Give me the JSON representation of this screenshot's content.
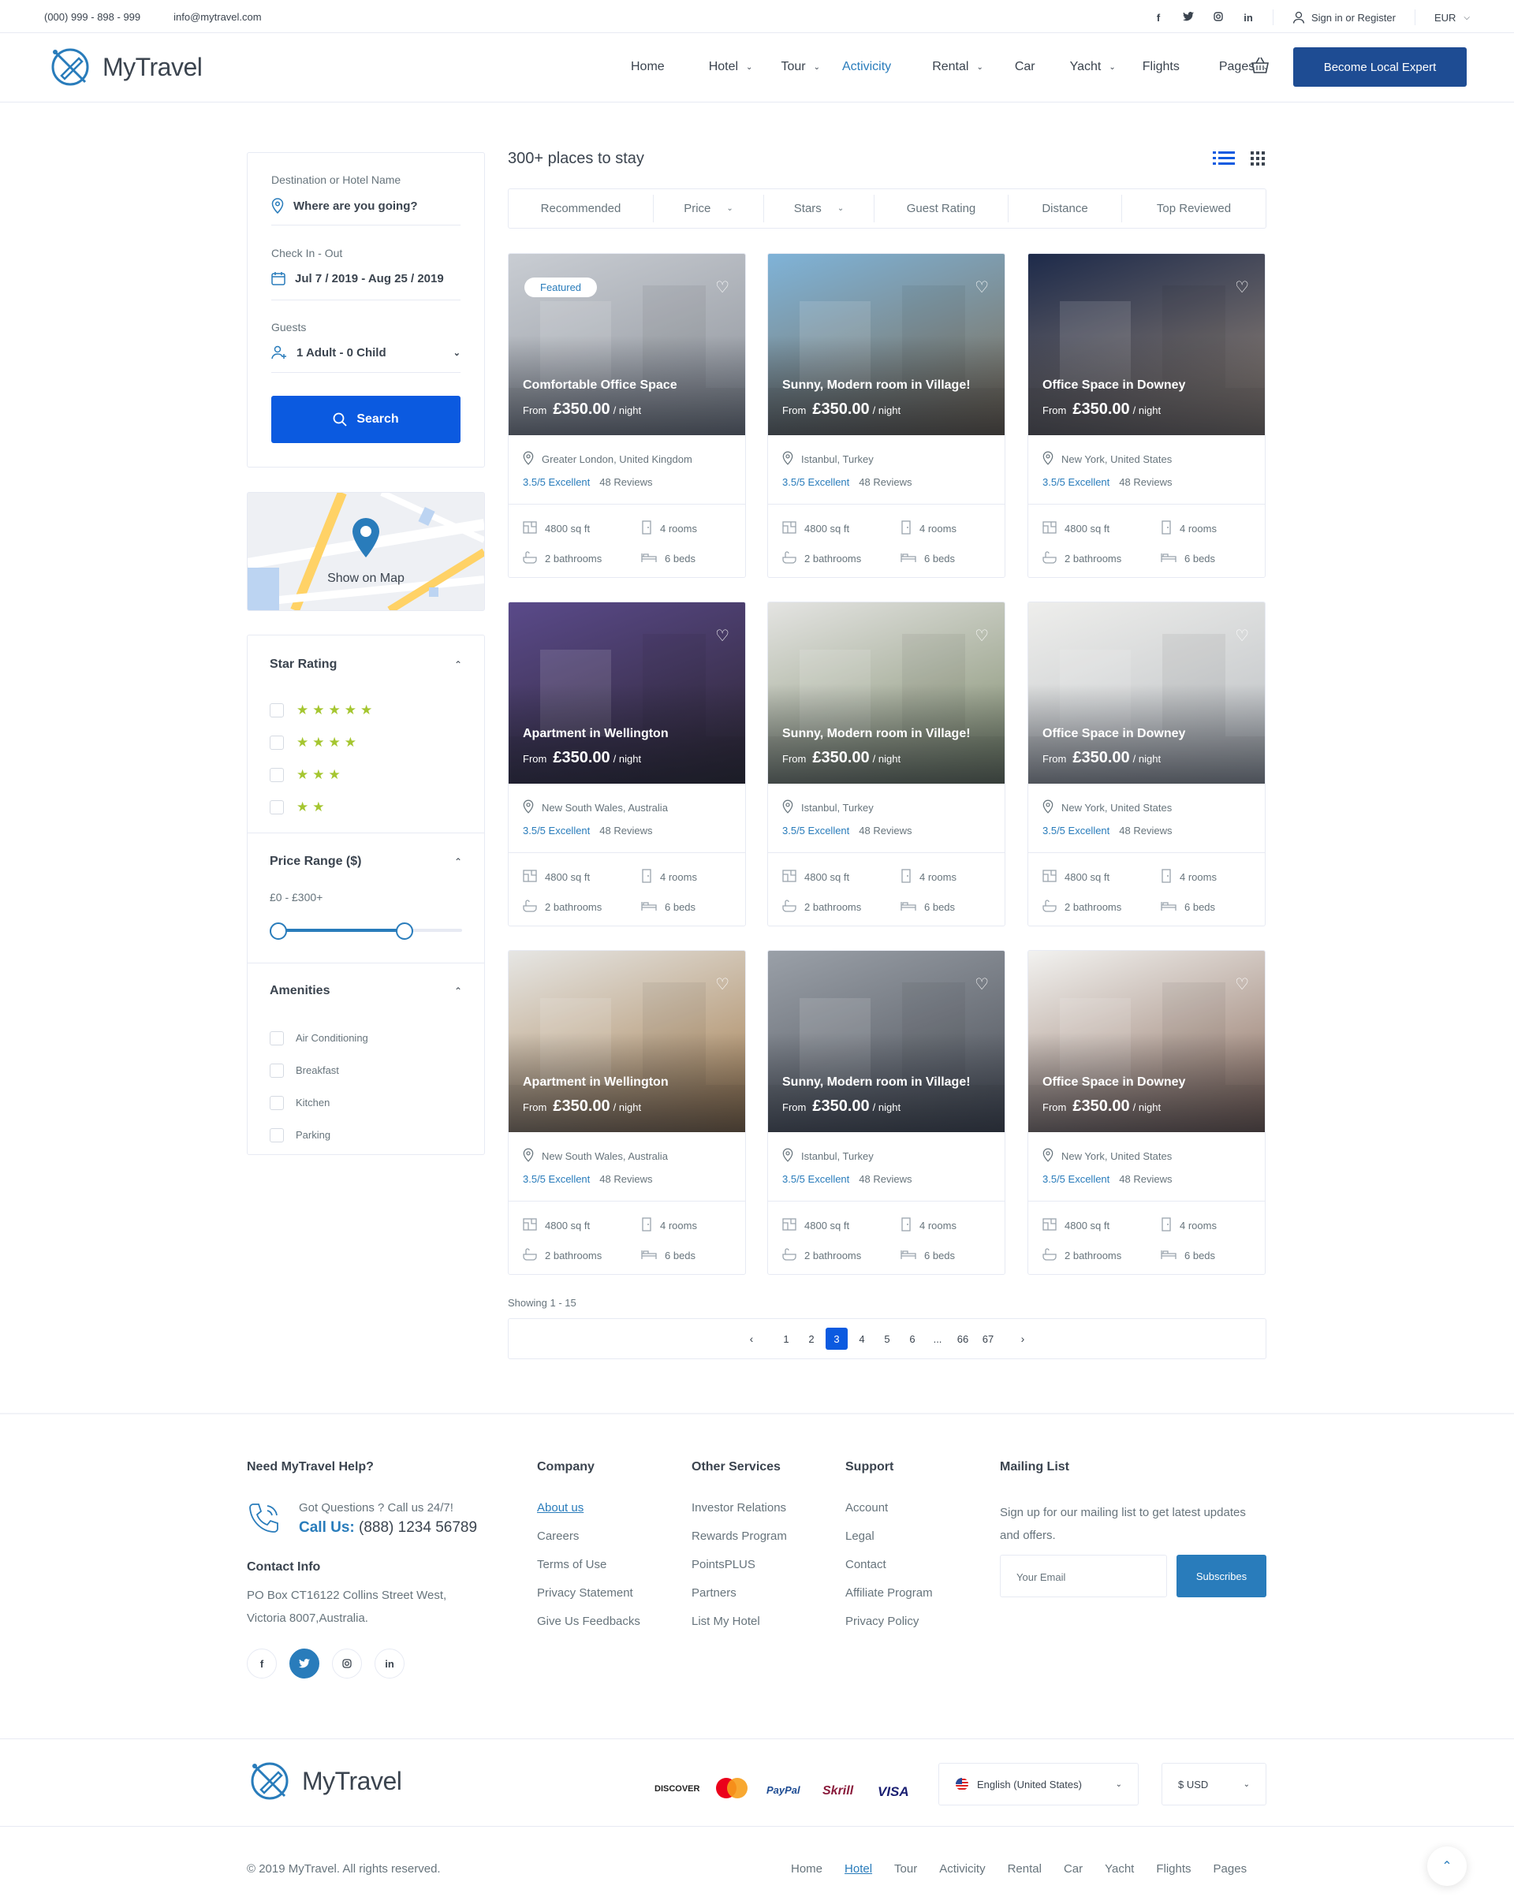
{
  "topbar": {
    "phone": "(000) 999 - 898 - 999",
    "email": "info@mytravel.com",
    "social": [
      "f",
      "t",
      "ig",
      "in"
    ],
    "signin": "Sign in or Register",
    "currency": "EUR"
  },
  "header": {
    "brand": "MyTravel",
    "nav": [
      {
        "label": "Home",
        "dropdown": false,
        "active": false
      },
      {
        "label": "Hotel",
        "dropdown": true,
        "active": false
      },
      {
        "label": "Tour",
        "dropdown": true,
        "active": false
      },
      {
        "label": "Activicity",
        "dropdown": false,
        "active": true
      },
      {
        "label": "Rental",
        "dropdown": true,
        "active": false
      },
      {
        "label": "Car",
        "dropdown": false,
        "active": false
      },
      {
        "label": "Yacht",
        "dropdown": true,
        "active": false
      },
      {
        "label": "Flights",
        "dropdown": false,
        "active": false
      },
      {
        "label": "Pages",
        "dropdown": true,
        "active": false
      }
    ],
    "cta": "Become Local Expert"
  },
  "search": {
    "dest_label": "Destination or Hotel Name",
    "dest_value": "Where are you going?",
    "dates_label": "Check In - Out",
    "dates_value": "Jul 7 / 2019 - Aug 25 / 2019",
    "guests_label": "Guests",
    "guests_value": "1 Adult - 0 Child",
    "button": "Search"
  },
  "map": {
    "label": "Show on Map"
  },
  "filters": {
    "star_title": "Star Rating",
    "stars": [
      5,
      4,
      3,
      2
    ],
    "price_title": "Price Range ($)",
    "price_range": "£0 - £300+",
    "price_min_fraction": 0,
    "price_max_fraction": 0.72,
    "amenities_title": "Amenities",
    "amenities": [
      "Air Conditioning",
      "Breakfast",
      "Kitchen",
      "Parking"
    ]
  },
  "results": {
    "title": "300+ places to stay",
    "sort": [
      "Recommended",
      "Price",
      "Stars",
      "Guest Rating",
      "Distance",
      "Top Reviewed"
    ],
    "sort_dropdown": [
      false,
      true,
      true,
      false,
      false,
      false
    ]
  },
  "listings": [
    {
      "featured": "Featured",
      "title": "Comfortable Office Space",
      "from": "From",
      "price": "£350.00",
      "per": "/ night",
      "location": "Greater London, United Kingdom",
      "rating": "3.5/5 Excellent",
      "reviews": "48 Reviews",
      "area": "4800 sq ft",
      "rooms": "4 rooms",
      "baths": "2 bathrooms",
      "beds": "6 beds",
      "palette": [
        "#c9cdd3",
        "#8c9199"
      ]
    },
    {
      "featured": "",
      "title": "Sunny, Modern room in Village!",
      "from": "From",
      "price": "£350.00",
      "per": "/ night",
      "location": "Istanbul, Turkey",
      "rating": "3.5/5 Excellent",
      "reviews": "48 Reviews",
      "area": "4800 sq ft",
      "rooms": "4 rooms",
      "baths": "2 bathrooms",
      "beds": "6 beds",
      "palette": [
        "#7fb3d8",
        "#7b6a52"
      ]
    },
    {
      "featured": "",
      "title": "Office Space in Downey",
      "from": "From",
      "price": "£350.00",
      "per": "/ night",
      "location": "New York, United States",
      "rating": "3.5/5 Excellent",
      "reviews": "48 Reviews",
      "area": "4800 sq ft",
      "rooms": "4 rooms",
      "baths": "2 bathrooms",
      "beds": "6 beds",
      "palette": [
        "#1d2a4a",
        "#9a8a7a"
      ]
    },
    {
      "featured": "",
      "title": "Apartment in Wellington",
      "from": "From",
      "price": "£350.00",
      "per": "/ night",
      "location": "New South Wales, Australia",
      "rating": "3.5/5 Excellent",
      "reviews": "48 Reviews",
      "area": "4800 sq ft",
      "rooms": "4 rooms",
      "baths": "2 bathrooms",
      "beds": "6 beds",
      "palette": [
        "#5a4a8a",
        "#2c2430"
      ]
    },
    {
      "featured": "",
      "title": "Sunny, Modern room in Village!",
      "from": "From",
      "price": "£350.00",
      "per": "/ night",
      "location": "Istanbul, Turkey",
      "rating": "3.5/5 Excellent",
      "reviews": "48 Reviews",
      "area": "4800 sq ft",
      "rooms": "4 rooms",
      "baths": "2 bathrooms",
      "beds": "6 beds",
      "palette": [
        "#e4e4e2",
        "#7d8a6a"
      ]
    },
    {
      "featured": "",
      "title": "Office Space in Downey",
      "from": "From",
      "price": "£350.00",
      "per": "/ night",
      "location": "New York, United States",
      "rating": "3.5/5 Excellent",
      "reviews": "48 Reviews",
      "area": "4800 sq ft",
      "rooms": "4 rooms",
      "baths": "2 bathrooms",
      "beds": "6 beds",
      "palette": [
        "#eeeeec",
        "#b8bcc0"
      ]
    },
    {
      "featured": "",
      "title": "Apartment in Wellington",
      "from": "From",
      "price": "£350.00",
      "per": "/ night",
      "location": "New South Wales, Australia",
      "rating": "3.5/5 Excellent",
      "reviews": "48 Reviews",
      "area": "4800 sq ft",
      "rooms": "4 rooms",
      "baths": "2 bathrooms",
      "beds": "6 beds",
      "palette": [
        "#e6e6e4",
        "#a27a4a"
      ]
    },
    {
      "featured": "",
      "title": "Sunny, Modern room in Village!",
      "from": "From",
      "price": "£350.00",
      "per": "/ night",
      "location": "Istanbul, Turkey",
      "rating": "3.5/5 Excellent",
      "reviews": "48 Reviews",
      "area": "4800 sq ft",
      "rooms": "4 rooms",
      "baths": "2 bathrooms",
      "beds": "6 beds",
      "palette": [
        "#9aa0a8",
        "#4a4e56"
      ]
    },
    {
      "featured": "",
      "title": "Office Space in Downey",
      "from": "From",
      "price": "£350.00",
      "per": "/ night",
      "location": "New York, United States",
      "rating": "3.5/5 Excellent",
      "reviews": "48 Reviews",
      "area": "4800 sq ft",
      "rooms": "4 rooms",
      "baths": "2 bathrooms",
      "beds": "6 beds",
      "palette": [
        "#f2f2f0",
        "#8a6a5a"
      ]
    }
  ],
  "pagination": {
    "showing": "Showing 1 - 15",
    "pages": [
      "1",
      "2",
      "3",
      "4",
      "5",
      "6",
      "...",
      "66",
      "67"
    ],
    "current": "3"
  },
  "footer": {
    "help_title": "Need MyTravel Help?",
    "help_q": "Got Questions ? Call us 24/7!",
    "call_label": "Call Us:",
    "call_number": "(888) 1234 56789",
    "contact_title": "Contact Info",
    "address1": "PO Box CT16122 Collins Street West,",
    "address2": "Victoria 8007,Australia.",
    "company_title": "Company",
    "company": [
      "About us",
      "Careers",
      "Terms of Use",
      "Privacy Statement",
      "Give Us Feedbacks"
    ],
    "services_title": "Other Services",
    "services": [
      "Investor Relations",
      "Rewards Program",
      "PointsPLUS",
      "Partners",
      "List My Hotel"
    ],
    "support_title": "Support",
    "support": [
      "Account",
      "Legal",
      "Contact",
      "Affiliate Program",
      "Privacy Policy"
    ],
    "mailing_title": "Mailing List",
    "mailing_text1": "Sign up for our mailing list to get latest updates",
    "mailing_text2": "and offers.",
    "email_placeholder": "Your Email",
    "subscribe": "Subscribes",
    "payments": [
      "DISCOVER",
      "MasterCard",
      "PayPal",
      "Skrill",
      "VISA"
    ],
    "language": "English (United States)",
    "currency": "$ USD",
    "copyright": "© 2019 MyTravel. All rights reserved.",
    "bottom_nav": [
      "Home",
      "Hotel",
      "Tour",
      "Activicity",
      "Rental",
      "Car",
      "Yacht",
      "Flights",
      "Pages"
    ]
  },
  "colors": {
    "primary": "#0b5ae0",
    "brand": "#297cbb",
    "star": "#a5c630",
    "dark_cta": "#1e4c93"
  }
}
